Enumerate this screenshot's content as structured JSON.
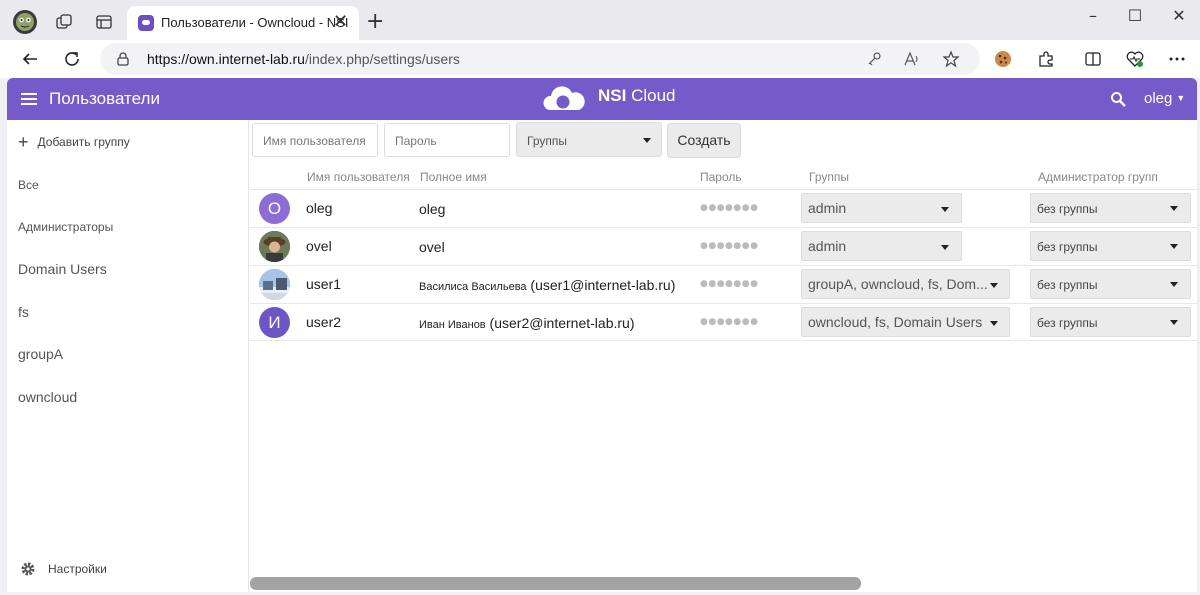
{
  "browser": {
    "tab_title": "Пользователи - Owncloud - NSI",
    "close_glyph": "✕",
    "new_tab_glyph": "+",
    "url_host": "https://own.internet-lab.ru",
    "url_path": "/index.php/settings/users",
    "window_controls": [
      "–",
      "☐",
      "✕"
    ]
  },
  "header": {
    "title": "Пользователи",
    "logo_bold": "NSI",
    "logo_rest": " Cloud",
    "user": "oleg",
    "accent_color": "#745bc9"
  },
  "sidebar": {
    "add_group": "Добавить группу",
    "groups": [
      {
        "label": "Все"
      },
      {
        "label": "Администраторы"
      },
      {
        "label": "Domain Users"
      },
      {
        "label": "fs"
      },
      {
        "label": "groupA"
      },
      {
        "label": "owncloud"
      }
    ],
    "settings": "Настройки"
  },
  "create_form": {
    "username_placeholder": "Имя пользователя",
    "password_placeholder": "Пароль",
    "groups_select": "Группы",
    "create_button": "Создать"
  },
  "table": {
    "headers": [
      "Имя пользователя",
      "Полное имя",
      "Пароль",
      "Группы",
      "Администратор групп"
    ],
    "rows": [
      {
        "avatar_letter": "O",
        "avatar_color": "#8e6cd8",
        "username": "oleg",
        "fullname": "oleg",
        "fullname_email": "",
        "password": "●●●●●●●",
        "groups": "admin",
        "admin_of": "без группы"
      },
      {
        "avatar_letter": "",
        "avatar_color": "#5a4a3a",
        "username": "ovel",
        "fullname": "ovel",
        "fullname_email": "",
        "password": "●●●●●●●",
        "groups": "admin",
        "admin_of": "без группы"
      },
      {
        "avatar_letter": "",
        "avatar_color": "#7a9cc8",
        "username": "user1",
        "fullname": "Василиса Васильева",
        "fullname_email": " (user1@internet-lab.ru)",
        "password": "●●●●●●●",
        "groups": "groupA, owncloud, fs, Dom...",
        "admin_of": "без группы"
      },
      {
        "avatar_letter": "И",
        "avatar_color": "#6e55c6",
        "username": "user2",
        "fullname": "Иван Иванов",
        "fullname_email": " (user2@internet-lab.ru)",
        "password": "●●●●●●●",
        "groups": "owncloud, fs, Domain Users",
        "admin_of": "без группы"
      }
    ]
  }
}
